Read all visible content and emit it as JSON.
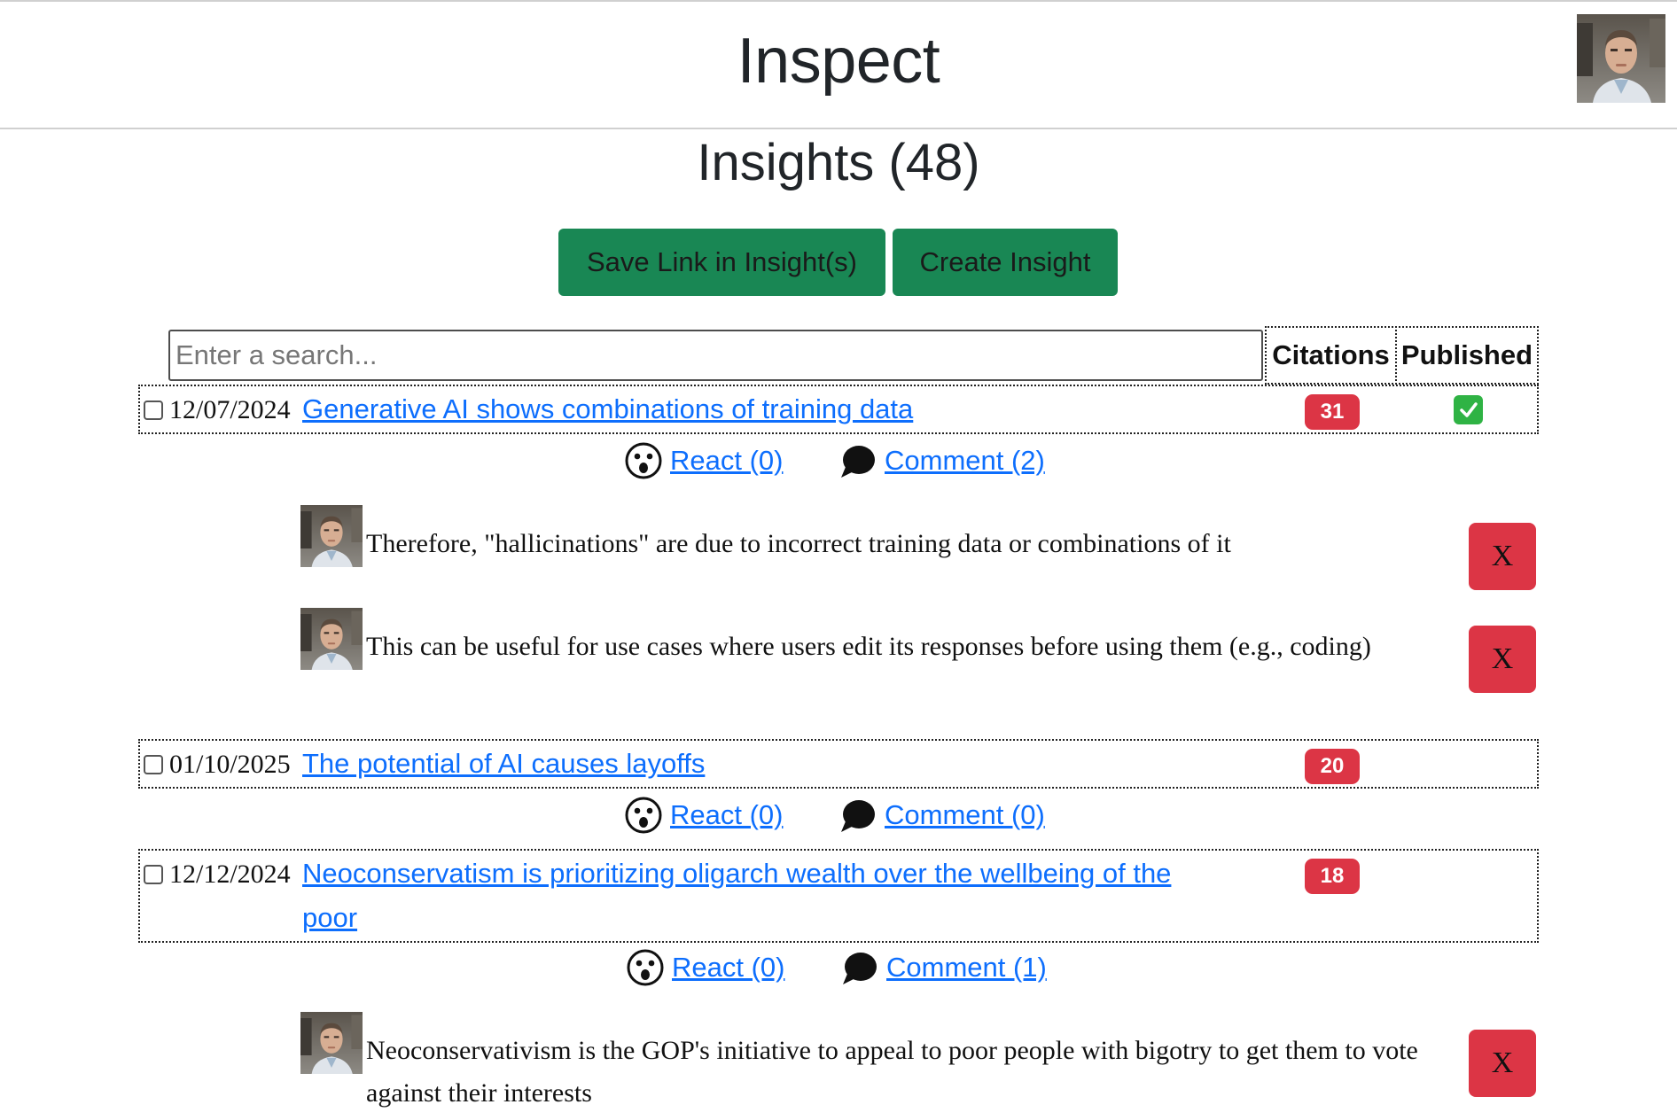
{
  "app": {
    "title": "Inspect"
  },
  "page": {
    "heading": "Insights (48)"
  },
  "buttons": {
    "save_link": "Save Link in Insight(s)",
    "create": "Create Insight"
  },
  "search": {
    "placeholder": "Enter a search..."
  },
  "columns": {
    "citations": "Citations",
    "published": "Published"
  },
  "insights": [
    {
      "date": "12/07/2024",
      "title": "Generative AI shows combinations of training data",
      "citations": "31",
      "published": true,
      "react_label": " React (0)",
      "comment_label": " Comment (2)",
      "comments": [
        "Therefore, \"hallicinations\" are due to incorrect training data or combinations of it",
        "This can be useful for use cases where users edit its responses before using them (e.g., coding)"
      ]
    },
    {
      "date": "01/10/2025",
      "title": "The potential of AI causes layoffs",
      "citations": "20",
      "published": false,
      "react_label": " React (0)",
      "comment_label": " Comment (0)",
      "comments": []
    },
    {
      "date": "12/12/2024",
      "title": "Neoconservatism is prioritizing oligarch wealth over the wellbeing of the poor",
      "citations": "18",
      "published": false,
      "react_label": " React (0)",
      "comment_label": " Comment (1)",
      "comments": [
        "Neoconservativism is the GOP's initiative to appeal to poor people with bigotry to get them to vote against their interests"
      ]
    }
  ],
  "delete_label": "X",
  "colors": {
    "accent_green": "#198754",
    "danger_red": "#dc3545",
    "link_blue": "#0d6efd",
    "published_green": "#2fb344"
  },
  "icons": {
    "react": "surprised-face-icon",
    "comment": "speech-bubble-icon",
    "published": "check-mark-icon"
  }
}
